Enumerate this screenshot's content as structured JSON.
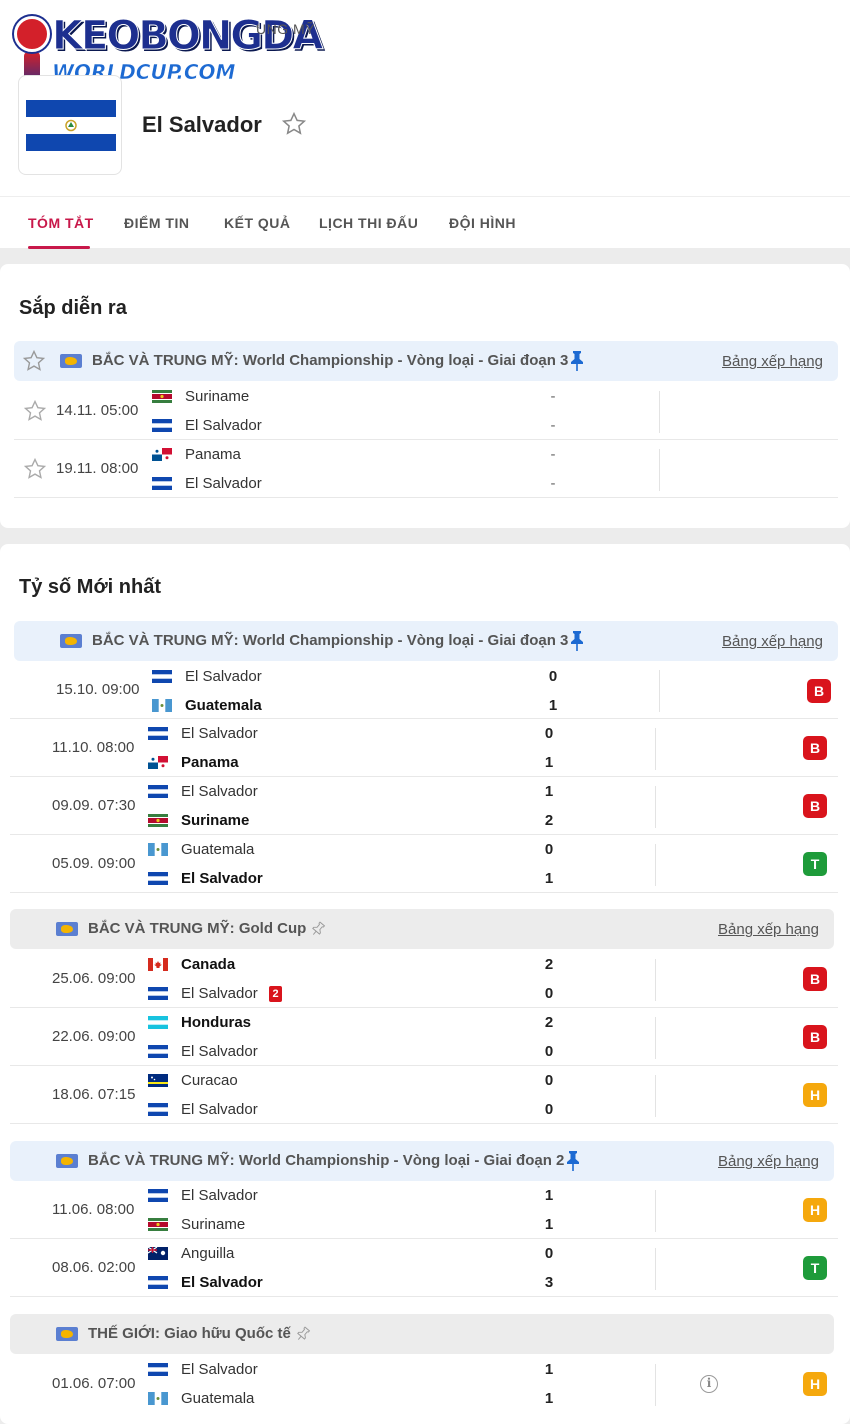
{
  "brand": {
    "logo_text_top": "KEOBONGDA",
    "logo_text_bottom": "WORLDCUP.COM"
  },
  "header": {
    "breadcrumb": "UNG MỸ",
    "team_name": "El Salvador"
  },
  "tabs": [
    {
      "label": "TÓM TẮT",
      "active": true
    },
    {
      "label": "ĐIỂM TIN"
    },
    {
      "label": "KẾT QUẢ"
    },
    {
      "label": "LỊCH THI ĐẤU"
    },
    {
      "label": "ĐỘI HÌNH"
    }
  ],
  "upcoming": {
    "title": "Sắp diễn ra",
    "league": {
      "name": "BẮC VÀ TRUNG MỸ: World Championship - Vòng loại - Giai đoạn 3",
      "rank_link": "Bảng xếp hạng"
    },
    "matches": [
      {
        "time": "14.11. 05:00",
        "home": "Suriname",
        "away": "El Salvador",
        "home_score": "-",
        "away_score": "-"
      },
      {
        "time": "19.11. 08:00",
        "home": "Panama",
        "away": "El Salvador",
        "home_score": "-",
        "away_score": "-"
      }
    ]
  },
  "latest": {
    "title": "Tỷ số Mới nhất",
    "groups": [
      {
        "league": "BẮC VÀ TRUNG MỸ: World Championship - Vòng loại - Giai đoạn 3",
        "rank_link": "Bảng xếp hạng",
        "matches": [
          {
            "time": "15.10. 09:00",
            "home": "El Salvador",
            "away": "Guatemala",
            "home_score": "0",
            "away_score": "1",
            "result": "B"
          },
          {
            "time": "11.10. 08:00",
            "home": "El Salvador",
            "away": "Panama",
            "home_score": "0",
            "away_score": "1",
            "result": "B"
          },
          {
            "time": "09.09. 07:30",
            "home": "El Salvador",
            "away": "Suriname",
            "home_score": "1",
            "away_score": "2",
            "result": "B"
          },
          {
            "time": "05.09. 09:00",
            "home": "Guatemala",
            "away": "El Salvador",
            "home_score": "0",
            "away_score": "1",
            "result": "T"
          }
        ]
      },
      {
        "league": "BẮC VÀ TRUNG MỸ: Gold Cup",
        "rank_link": "Bảng xếp hạng",
        "matches": [
          {
            "time": "25.06. 09:00",
            "home": "Canada",
            "away": "El Salvador",
            "home_score": "2",
            "away_score": "0",
            "result": "B",
            "away_red_cards": "2"
          },
          {
            "time": "22.06. 09:00",
            "home": "Honduras",
            "away": "El Salvador",
            "home_score": "2",
            "away_score": "0",
            "result": "B"
          },
          {
            "time": "18.06. 07:15",
            "home": "Curacao",
            "away": "El Salvador",
            "home_score": "0",
            "away_score": "0",
            "result": "H"
          }
        ]
      },
      {
        "league": "BẮC VÀ TRUNG MỸ: World Championship - Vòng loại - Giai đoạn 2",
        "rank_link": "Bảng xếp hạng",
        "matches": [
          {
            "time": "11.06. 08:00",
            "home": "El Salvador",
            "away": "Suriname",
            "home_score": "1",
            "away_score": "1",
            "result": "H"
          },
          {
            "time": "08.06. 02:00",
            "home": "Anguilla",
            "away": "El Salvador",
            "home_score": "0",
            "away_score": "3",
            "result": "T"
          }
        ]
      },
      {
        "league": "THẾ GIỚI: Giao hữu Quốc tế",
        "matches": [
          {
            "time": "01.06. 07:00",
            "home": "El Salvador",
            "away": "Guatemala",
            "home_score": "1",
            "away_score": "1",
            "result": "H",
            "info": "i"
          }
        ]
      }
    ]
  },
  "colors": {
    "accent": "#c8184a",
    "loss": "#d9141c",
    "win": "#1e9b3a",
    "draw": "#f5a80d",
    "league_bar": "#e9f1fb"
  }
}
